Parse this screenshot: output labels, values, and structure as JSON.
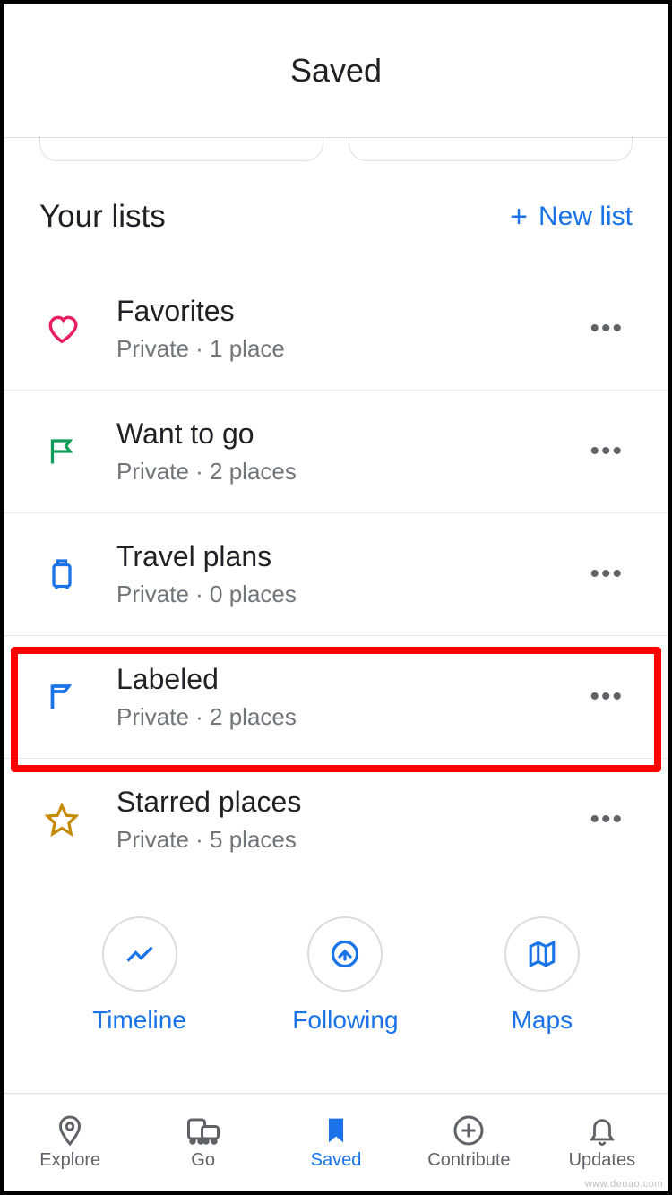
{
  "header": {
    "title": "Saved"
  },
  "section": {
    "title": "Your lists",
    "new_list": "New list"
  },
  "lists": [
    {
      "title": "Favorites",
      "sub": "Private · 1 place"
    },
    {
      "title": "Want to go",
      "sub": "Private · 2 places"
    },
    {
      "title": "Travel plans",
      "sub": "Private · 0 places"
    },
    {
      "title": "Labeled",
      "sub": "Private · 2 places"
    },
    {
      "title": "Starred places",
      "sub": "Private · 5 places"
    }
  ],
  "chips": [
    {
      "label": "Timeline"
    },
    {
      "label": "Following"
    },
    {
      "label": "Maps"
    }
  ],
  "nav": [
    {
      "label": "Explore"
    },
    {
      "label": "Go"
    },
    {
      "label": "Saved"
    },
    {
      "label": "Contribute"
    },
    {
      "label": "Updates"
    }
  ],
  "watermark": "www.deuao.com"
}
